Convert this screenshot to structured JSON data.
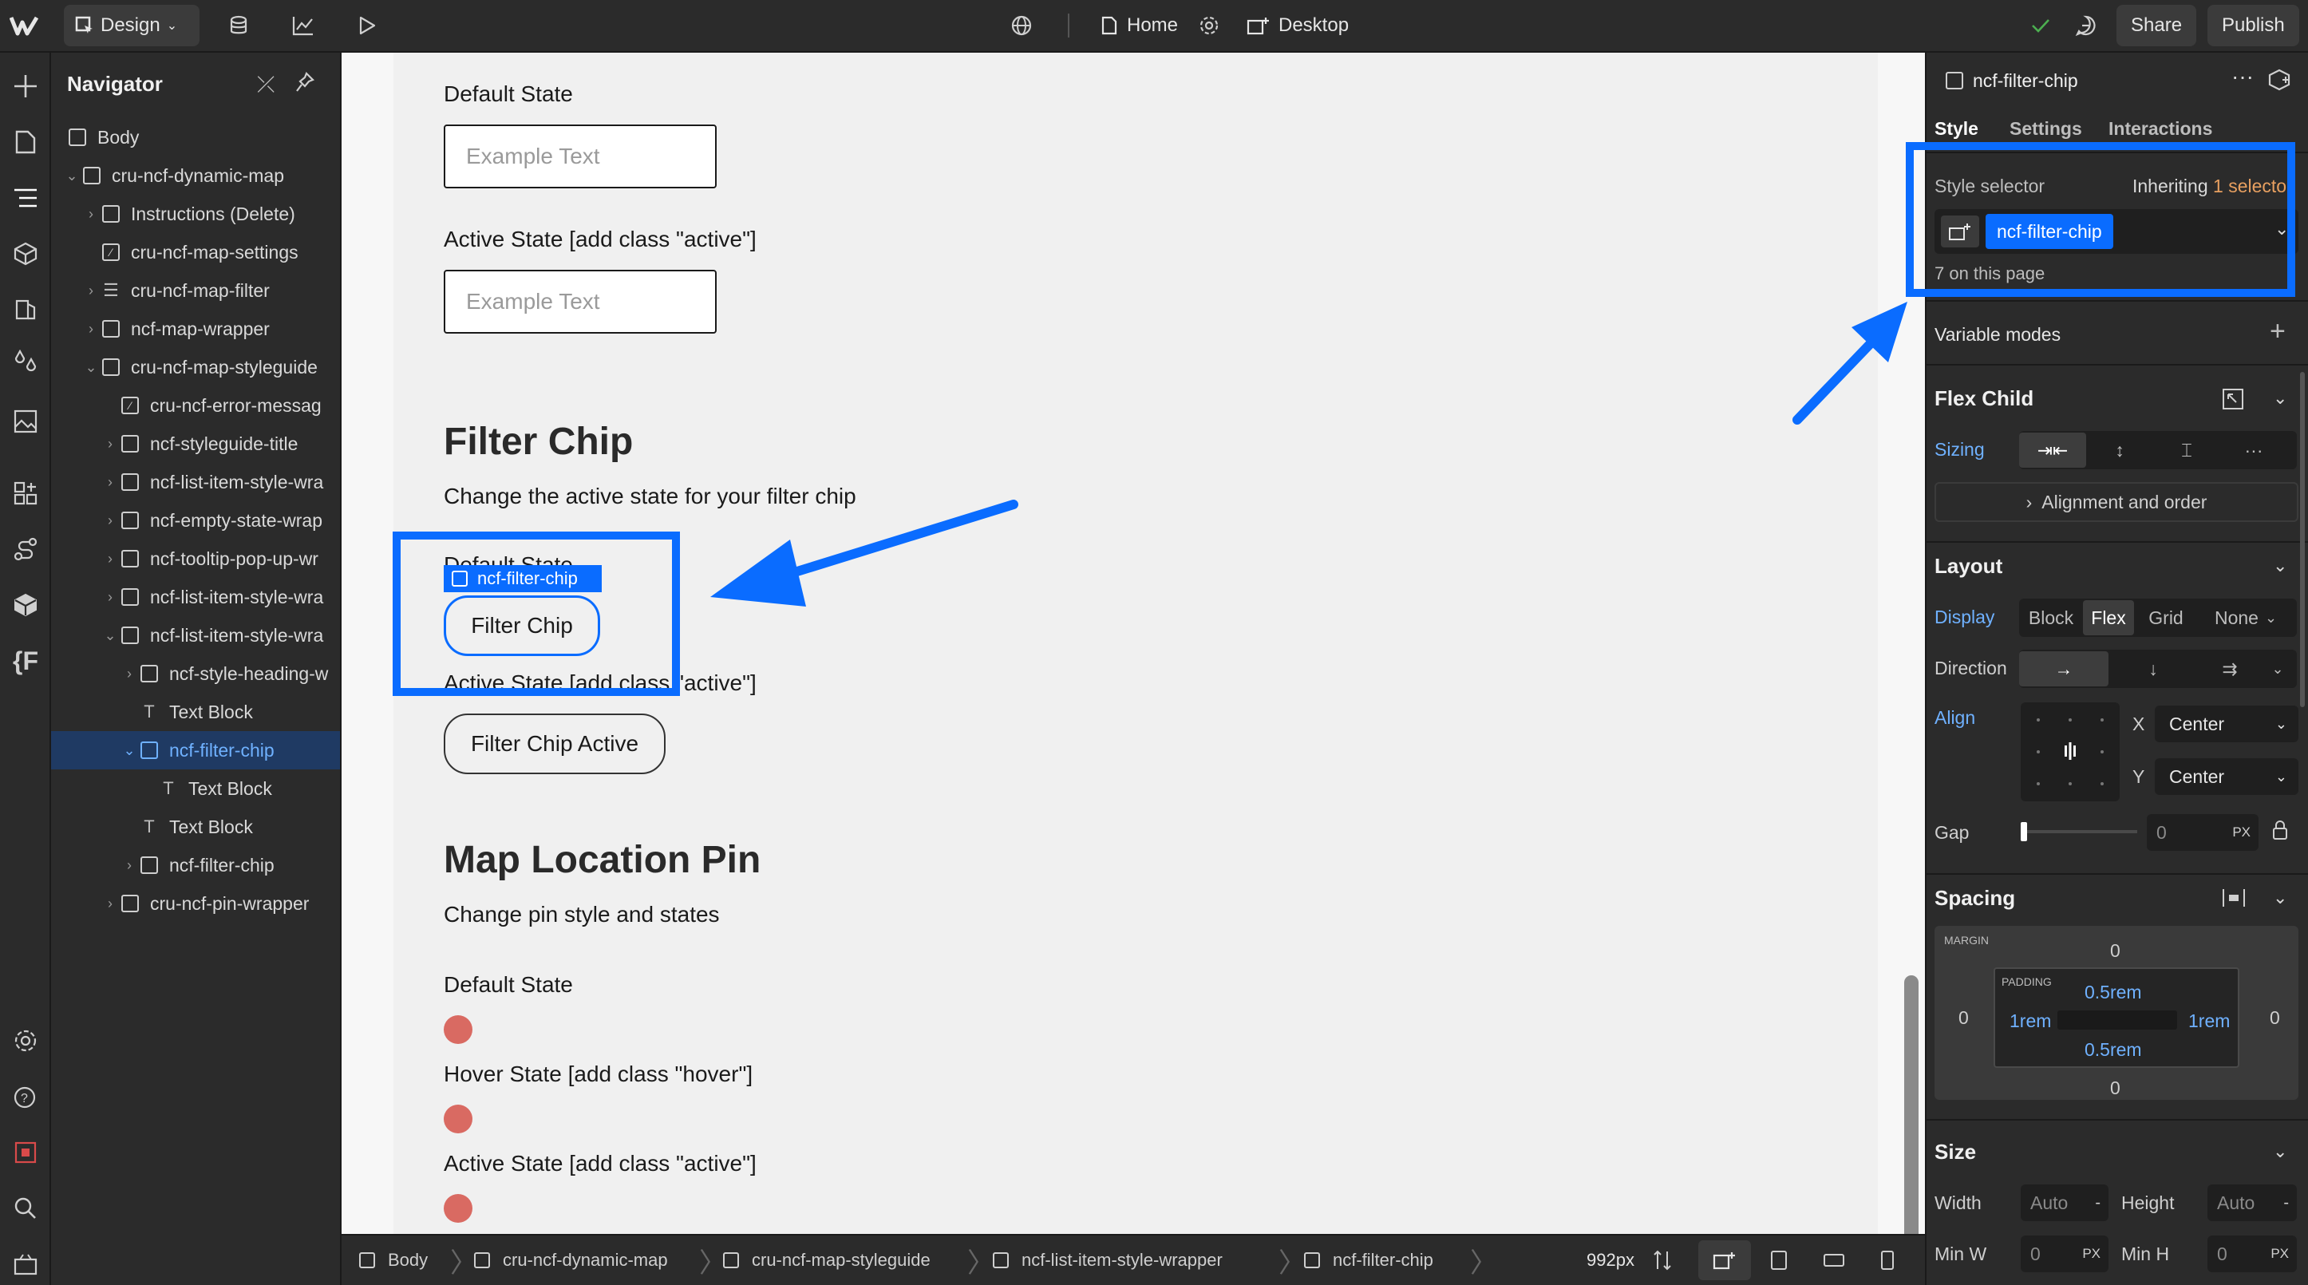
{
  "topbar": {
    "design_label": "Design",
    "page_label": "Home",
    "breakpoint_label": "Desktop",
    "share_label": "Share",
    "publish_label": "Publish"
  },
  "navigator": {
    "title": "Navigator",
    "items": [
      {
        "label": "Body"
      },
      {
        "label": "cru-ncf-dynamic-map"
      },
      {
        "label": "Instructions (Delete)"
      },
      {
        "label": "cru-ncf-map-settings"
      },
      {
        "label": "cru-ncf-map-filter"
      },
      {
        "label": "ncf-map-wrapper"
      },
      {
        "label": "cru-ncf-map-styleguide"
      },
      {
        "label": "cru-ncf-error-messag"
      },
      {
        "label": "ncf-styleguide-title"
      },
      {
        "label": "ncf-list-item-style-wra"
      },
      {
        "label": "ncf-empty-state-wrap"
      },
      {
        "label": "ncf-tooltip-pop-up-wr"
      },
      {
        "label": "ncf-list-item-style-wra"
      },
      {
        "label": "ncf-list-item-style-wra"
      },
      {
        "label": "ncf-style-heading-w"
      },
      {
        "label": "Text Block"
      },
      {
        "label": "ncf-filter-chip"
      },
      {
        "label": "Text Block"
      },
      {
        "label": "Text Block"
      },
      {
        "label": "ncf-filter-chip"
      },
      {
        "label": "cru-ncf-pin-wrapper"
      }
    ]
  },
  "canvas": {
    "default_state_1": "Default State",
    "example_text_1": "Example Text",
    "active_state_1": "Active State [add class \"active\"]",
    "example_text_2": "Example Text",
    "filter_heading": "Filter Chip",
    "filter_desc": "Change the active state for your filter chip",
    "default_state_2": "Default State",
    "selection_badge": "ncf-filter-chip",
    "filter_chip": "Filter Chip",
    "active_state_2": "Active State [add class \"active\"]",
    "filter_chip_active": "Filter Chip Active",
    "map_heading": "Map Location Pin",
    "map_desc": "Change pin style and states",
    "default_state_3": "Default State",
    "hover_state": "Hover State [add class \"hover\"]",
    "active_state_3": "Active State [add class \"active\"]"
  },
  "breadcrumbs": {
    "items": [
      "Body",
      "cru-ncf-dynamic-map",
      "cru-ncf-map-styleguide",
      "ncf-list-item-style-wrapper",
      "ncf-filter-chip"
    ],
    "width_readout": "992px"
  },
  "panel": {
    "element_name": "ncf-filter-chip",
    "tabs": [
      "Style",
      "Settings",
      "Interactions"
    ],
    "style_selector_label": "Style selector",
    "inheriting_prefix": "Inheriting",
    "inheriting_link": "1 selecto",
    "selector_chip": "ncf-filter-chip",
    "on_page": "7 on this page",
    "variable_modes": "Variable modes",
    "flex_child": "Flex Child",
    "sizing_label": "Sizing",
    "alignment_order": "Alignment and order",
    "layout": "Layout",
    "display_label": "Display",
    "display_options": [
      "Block",
      "Flex",
      "Grid",
      "None"
    ],
    "direction_label": "Direction",
    "align_label": "Align",
    "x_label": "X",
    "x_value": "Center",
    "y_label": "Y",
    "y_value": "Center",
    "gap_label": "Gap",
    "gap_value": "0",
    "gap_unit": "PX",
    "spacing": "Spacing",
    "margin_label": "MARGIN",
    "padding_label": "PADDING",
    "margin_top": "0",
    "margin_left": "0",
    "margin_right": "0",
    "margin_bottom": "0",
    "padding_top": "0.5rem",
    "padding_left": "1rem",
    "padding_right": "1rem",
    "padding_bottom": "0.5rem",
    "size": "Size",
    "width_label": "Width",
    "width_value": "Auto",
    "height_label": "Height",
    "height_value": "Auto",
    "minw_label": "Min W",
    "minw_value": "0",
    "minw_unit": "PX",
    "minh_label": "Min H",
    "minh_value": "0",
    "minh_unit": "PX"
  },
  "colors": {
    "accent": "#0a6cff",
    "selection_blue": "#1f3a63",
    "pin": "#d96a62"
  }
}
